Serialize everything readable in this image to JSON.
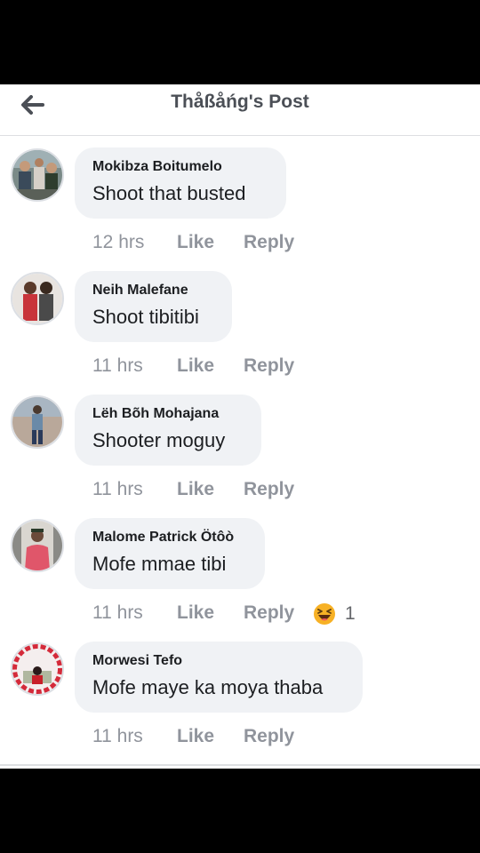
{
  "header": {
    "title": "Thåßåńg's Post",
    "back_icon": "arrow-left-icon"
  },
  "comments": [
    {
      "author": "Mokibza Boitumelo",
      "text": "Shoot that busted",
      "time": "12 hrs",
      "like_label": "Like",
      "reply_label": "Reply"
    },
    {
      "author": "Neih Malefane",
      "text": "Shoot tibitibi",
      "time": "11 hrs",
      "like_label": "Like",
      "reply_label": "Reply"
    },
    {
      "author": "Lëh Bõh Mohajana",
      "text": "Shooter moguy",
      "time": "11 hrs",
      "like_label": "Like",
      "reply_label": "Reply"
    },
    {
      "author": "Malome Patrick Ötôò",
      "text": "Mofe mmae tibi",
      "time": "11 hrs",
      "like_label": "Like",
      "reply_label": "Reply",
      "reaction": {
        "icon": "haha-reaction-icon",
        "count": "1"
      }
    },
    {
      "author": "Morwesi Tefo",
      "text": "Mofe maye ka moya thaba",
      "time": "11 hrs",
      "like_label": "Like",
      "reply_label": "Reply"
    }
  ],
  "colors": {
    "bubble_bg": "#f0f2f5",
    "meta_text": "#90949c",
    "title_text": "#4b4f56",
    "haha_yellow": "#f7b125"
  }
}
